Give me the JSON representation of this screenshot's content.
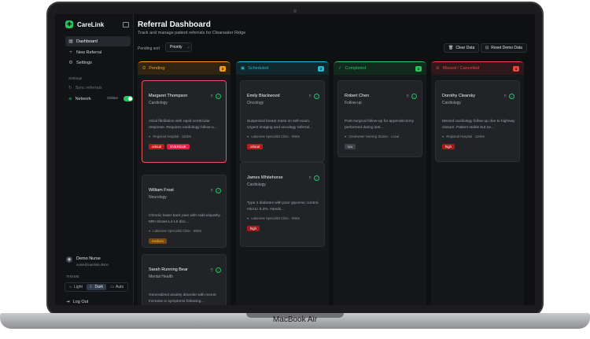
{
  "app": {
    "name": "CareLink"
  },
  "sidebar": {
    "items": [
      {
        "label": "Dashboard",
        "icon": "grid-icon"
      },
      {
        "label": "New Referral",
        "icon": "plus-icon"
      },
      {
        "label": "Settings",
        "icon": "gear-icon"
      }
    ],
    "settings_label": "Settings",
    "sync_label": "Sync referrals",
    "network_label": "Network",
    "network_status": "Online",
    "user_name": "Demo Nurse",
    "user_email": "nurse@carelink.demo",
    "theme_label": "THEME",
    "themes": [
      "Light",
      "Dark",
      "Auto"
    ],
    "active_theme": "Dark",
    "logout_label": "Log Out"
  },
  "header": {
    "title": "Referral Dashboard",
    "subtitle": "Track and manage patient referrals for Clearwater Ridge",
    "sort_label": "Pending sort",
    "sort_value": "Priority",
    "clear_label": "Clear Data",
    "reset_label": "Reset Demo Data"
  },
  "columns": [
    {
      "title": "Pending",
      "count": "3",
      "accent": "#f59e0b",
      "cards": [
        {
          "name": "Margaret Thompson",
          "dept": "Cardiology",
          "desc": "Atrial fibrillation with rapid ventricular response. Requires cardiology follow-u...",
          "location": "Regional Hospital · 110km",
          "tags": [
            {
              "label": "critical",
              "kind": "critical"
            },
            {
              "label": "OVERDUE",
              "kind": "overdue"
            }
          ]
        },
        {
          "name": "William Frost",
          "dept": "Neurology",
          "desc": "Chronic lower back pain with radiculopathy. MRI shows L4-L5 disc...",
          "location": "Lakeview Specialist Clinic · 95km",
          "tags": [
            {
              "label": "medium",
              "kind": "medium"
            }
          ]
        },
        {
          "name": "Sarah Running Bear",
          "dept": "Mental Health",
          "desc": "Generalized anxiety disorder with recent increase in symptoms following...",
          "location": "",
          "tags": []
        }
      ]
    },
    {
      "title": "Scheduled",
      "count": "2",
      "accent": "#22b8cf",
      "cards": [
        {
          "name": "Emily Blackwood",
          "dept": "Oncology",
          "desc": "Suspected breast mass on self-exam. Urgent imaging and oncology referral...",
          "location": "Lakeview Specialist Clinic · 95km",
          "tags": [
            {
              "label": "critical",
              "kind": "critical"
            }
          ]
        },
        {
          "name": "James Whitehorse",
          "dept": "Cardiology",
          "desc": "Type 2 diabetes with poor glycemic control. HbA1c 9.2%. Needs...",
          "location": "Lakeview Specialist Clinic · 95km",
          "tags": [
            {
              "label": "high",
              "kind": "high"
            }
          ]
        }
      ]
    },
    {
      "title": "Completed",
      "count": "1",
      "accent": "#22c55e",
      "cards": [
        {
          "name": "Robert Chen",
          "dept": "Follow-up",
          "desc": "Post-surgical follow-up for appendectomy performed during last...",
          "location": "Clearwater Nursing Station · Local",
          "tags": [
            {
              "label": "low",
              "kind": "low"
            }
          ]
        }
      ]
    },
    {
      "title": "Missed / Cancelled",
      "count": "1",
      "accent": "#ef4444",
      "cards": [
        {
          "name": "Dorothy Clearsky",
          "dept": "Cardiology",
          "desc": "Missed cardiology follow-up due to highway closure. Patient stable but ne...",
          "location": "Regional Hospital · 110km",
          "tags": [
            {
              "label": "high",
              "kind": "high"
            }
          ]
        }
      ]
    }
  ],
  "device": {
    "label": "MacBook Air"
  }
}
